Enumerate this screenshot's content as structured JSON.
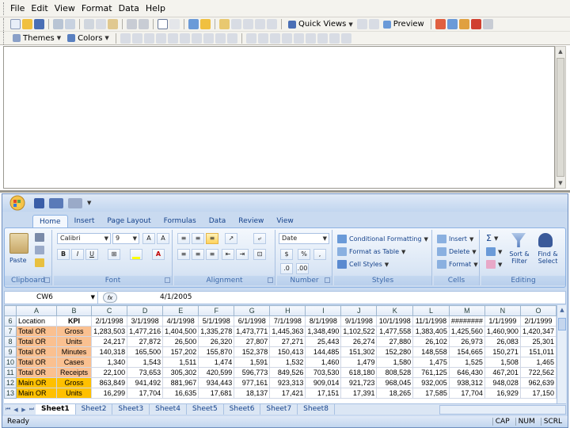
{
  "menubar": {
    "items": [
      {
        "label": "File"
      },
      {
        "label": "Edit"
      },
      {
        "label": "View"
      },
      {
        "label": "Format"
      },
      {
        "label": "Data"
      },
      {
        "label": "Help"
      }
    ]
  },
  "toolbar1": {
    "quick_views_label": "Quick Views",
    "preview_label": "Preview"
  },
  "toolbar2": {
    "themes_label": "Themes",
    "colors_label": "Colors"
  },
  "excel": {
    "ribbon_tabs": [
      "Home",
      "Insert",
      "Page Layout",
      "Formulas",
      "Data",
      "Review",
      "View"
    ],
    "active_tab": "Home",
    "groups": {
      "clipboard": {
        "label": "Clipboard",
        "paste_label": "Paste"
      },
      "font": {
        "label": "Font",
        "font_name": "Calibri",
        "font_size": "9"
      },
      "alignment": {
        "label": "Alignment"
      },
      "number": {
        "label": "Number",
        "format": "Date",
        "currency": "$",
        "percent": "%",
        "comma": ","
      },
      "styles": {
        "label": "Styles",
        "conditional_formatting": "Conditional Formatting",
        "format_as_table": "Format as Table",
        "cell_styles": "Cell Styles"
      },
      "cells": {
        "label": "Cells",
        "insert": "Insert",
        "delete": "Delete",
        "format": "Format"
      },
      "editing": {
        "label": "Editing",
        "sum": "Σ",
        "sort_filter": "Sort & Filter",
        "find_select": "Find & Select"
      }
    },
    "name_box": "CW6",
    "fx": "fx",
    "formula_value": "4/1/2005",
    "columns": [
      "A",
      "B",
      "C",
      "D",
      "E",
      "F",
      "G",
      "H",
      "I",
      "J",
      "K",
      "L",
      "M",
      "N",
      "O"
    ],
    "rows": [
      {
        "num": "6",
        "cells": [
          "Location",
          "KPI",
          "2/1/1998",
          "3/1/1998",
          "4/1/1998",
          "5/1/1998",
          "6/1/1998",
          "7/1/1998",
          "8/1/1998",
          "9/1/1998",
          "10/1/1998",
          "11/1/1998",
          "########",
          "1/1/1999",
          "2/1/1999"
        ],
        "loc_style": "none"
      },
      {
        "num": "7",
        "cells": [
          "Total OR",
          "Gross",
          "1,283,503",
          "1,477,216",
          "1,404,500",
          "1,335,278",
          "1,473,771",
          "1,445,363",
          "1,348,490",
          "1,102,522",
          "1,477,558",
          "1,383,405",
          "1,425,560",
          "1,460,900",
          "1,420,347"
        ],
        "loc_style": "orange"
      },
      {
        "num": "8",
        "cells": [
          "Total OR",
          "Units",
          "24,217",
          "27,872",
          "26,500",
          "26,320",
          "27,807",
          "27,271",
          "25,443",
          "26,274",
          "27,880",
          "26,102",
          "26,973",
          "26,083",
          "25,301"
        ],
        "loc_style": "orange"
      },
      {
        "num": "9",
        "cells": [
          "Total OR",
          "Minutes",
          "140,318",
          "165,500",
          "157,202",
          "155,870",
          "152,378",
          "150,413",
          "144,485",
          "151,302",
          "152,280",
          "148,558",
          "154,665",
          "150,271",
          "151,011"
        ],
        "loc_style": "orange"
      },
      {
        "num": "10",
        "cells": [
          "Total OR",
          "Cases",
          "1,340",
          "1,543",
          "1,511",
          "1,474",
          "1,591",
          "1,532",
          "1,460",
          "1,479",
          "1,580",
          "1,475",
          "1,525",
          "1,508",
          "1,465"
        ],
        "loc_style": "orange"
      },
      {
        "num": "11",
        "cells": [
          "Total OR",
          "Receipts",
          "22,100",
          "73,653",
          "305,302",
          "420,599",
          "596,773",
          "849,526",
          "703,530",
          "618,180",
          "808,528",
          "761,125",
          "646,430",
          "467,201",
          "722,562"
        ],
        "loc_style": "orange"
      },
      {
        "num": "12",
        "cells": [
          "Main OR",
          "Gross",
          "863,849",
          "941,492",
          "881,967",
          "934,443",
          "977,161",
          "923,313",
          "909,014",
          "921,723",
          "968,045",
          "932,005",
          "938,312",
          "948,028",
          "962,639"
        ],
        "loc_style": "yellow"
      },
      {
        "num": "13",
        "cells": [
          "Main OR",
          "Units",
          "16,299",
          "17,704",
          "16,635",
          "17,681",
          "18,137",
          "17,421",
          "17,151",
          "17,391",
          "18,265",
          "17,585",
          "17,704",
          "16,929",
          "17,150"
        ],
        "loc_style": "yellow"
      }
    ],
    "sheet_tabs": [
      "Sheet1",
      "Sheet2",
      "Sheet3",
      "Sheet4",
      "Sheet5",
      "Sheet6",
      "Sheet7",
      "Sheet8"
    ],
    "active_sheet": "Sheet1",
    "status": "Ready",
    "indicators": [
      "CAP",
      "NUM",
      "SCRL"
    ]
  }
}
